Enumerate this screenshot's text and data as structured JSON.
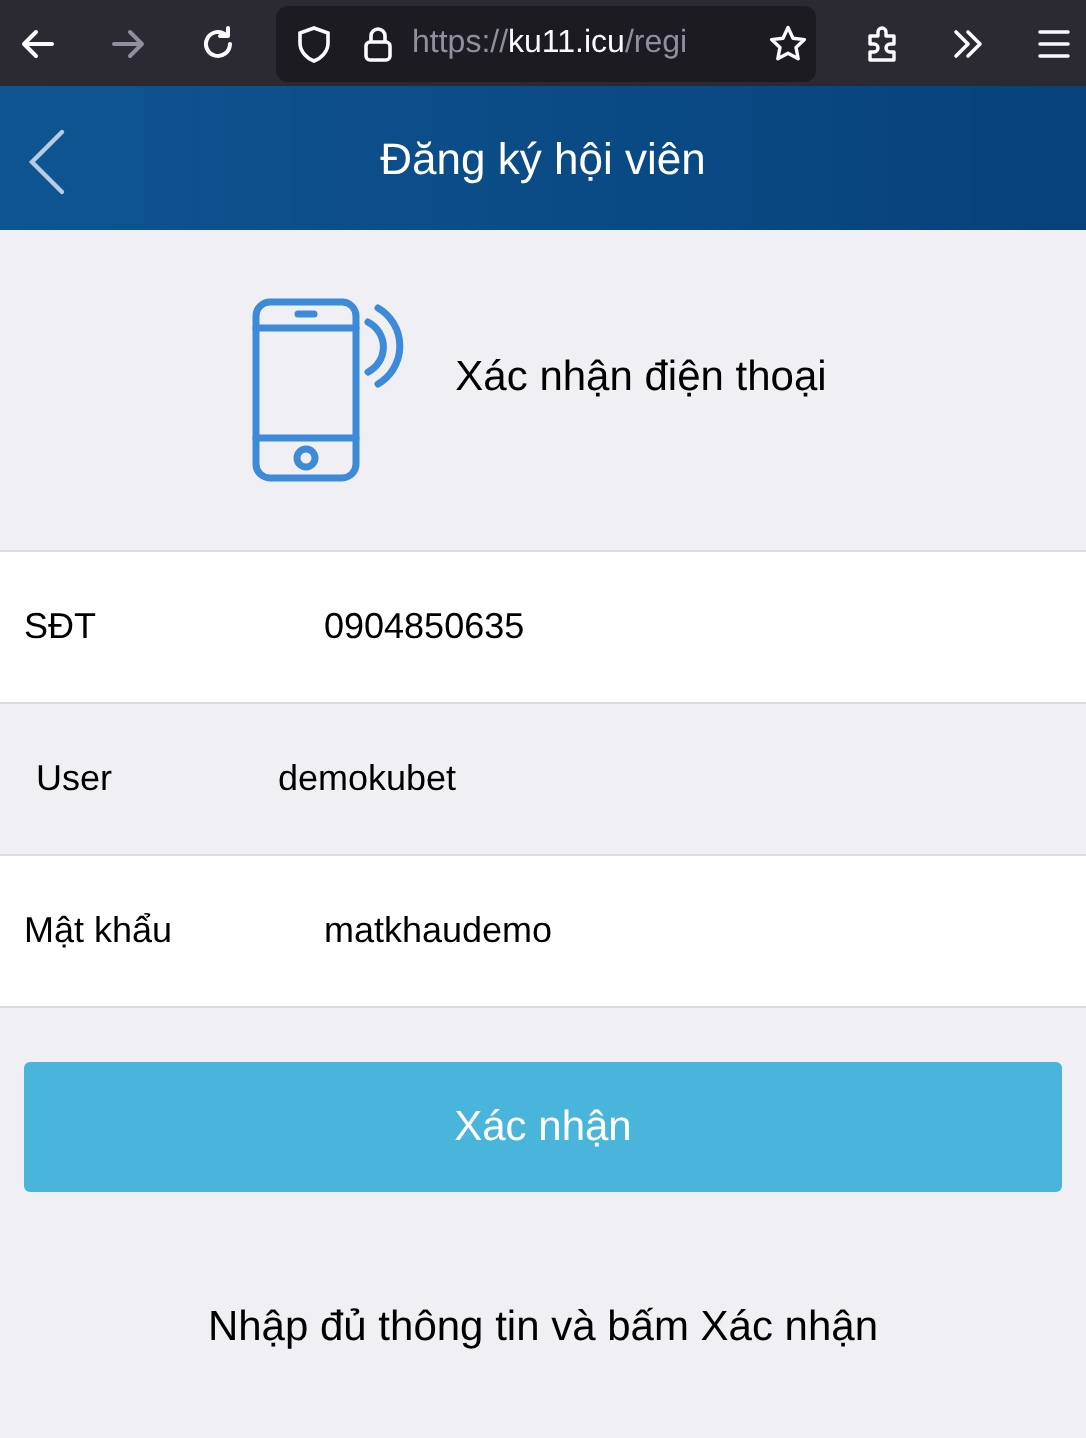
{
  "browser": {
    "url_prefix": "https://",
    "url_host": "ku11.icu",
    "url_rest": "/regi"
  },
  "header": {
    "title": "Đăng ký hội viên"
  },
  "hero": {
    "title": "Xác nhận điện thoại"
  },
  "fields": [
    {
      "label": "SĐT",
      "value": "0904850635"
    },
    {
      "label": "User",
      "value": "demokubet"
    },
    {
      "label": "Mật khẩu",
      "value": "matkhaudemo"
    }
  ],
  "submit": {
    "label": "Xác nhận"
  },
  "hint": "Nhập đủ thông tin và bấm Xác nhận"
}
